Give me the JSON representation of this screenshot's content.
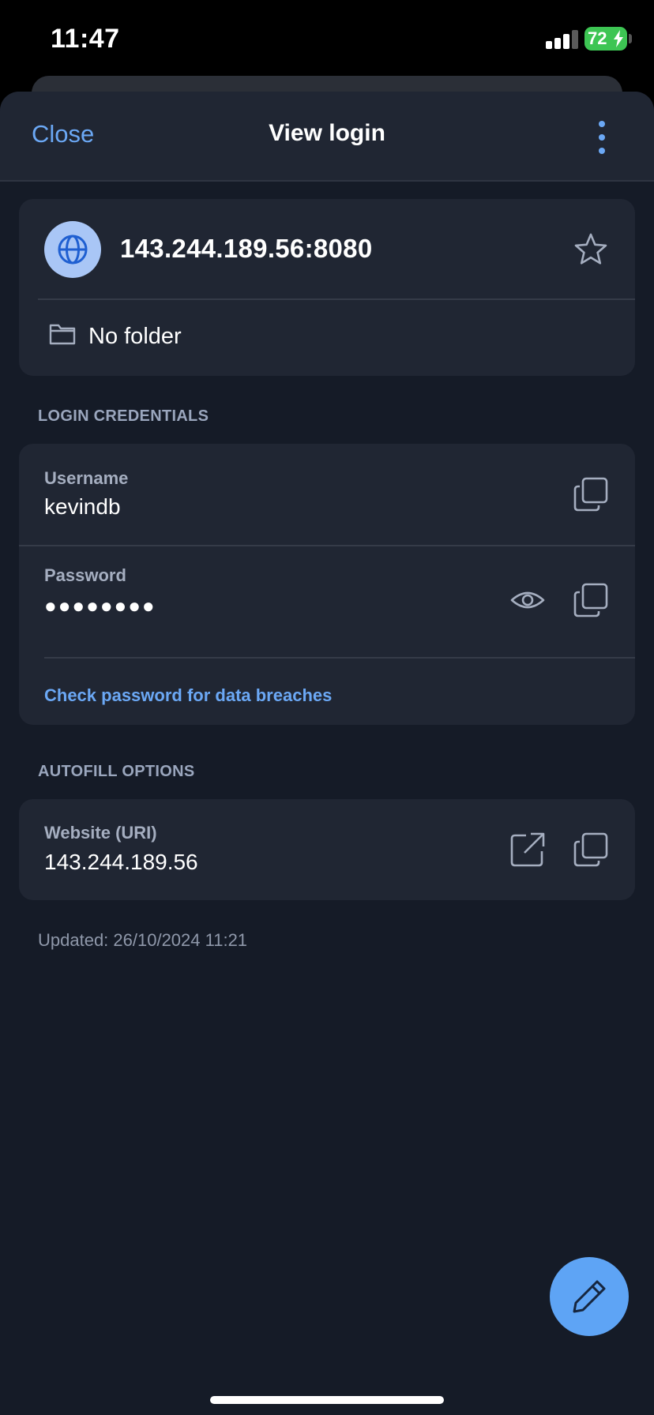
{
  "status_bar": {
    "time": "11:47",
    "battery_percent": "72",
    "signal_icon": "cellular-signal-icon",
    "battery_color": "#3dc553"
  },
  "nav": {
    "close_label": "Close",
    "title": "View login",
    "more_icon": "more-vertical-icon"
  },
  "item": {
    "name": "143.244.189.56:8080",
    "icon": "globe-icon",
    "favorite_icon": "star-icon",
    "folder_icon": "folder-icon",
    "folder": "No folder"
  },
  "login_credentials": {
    "section_label": "LOGIN CREDENTIALS",
    "username_label": "Username",
    "username_value": "kevindb",
    "password_label": "Password",
    "password_masked": "●●●●●●●●",
    "check_breaches_label": "Check password for data breaches"
  },
  "autofill": {
    "section_label": "AUTOFILL OPTIONS",
    "website_label": "Website (URI)",
    "website_value": "143.244.189.56"
  },
  "updated_text": "Updated: 26/10/2024 11:21",
  "fab_icon": "pencil-edit-icon",
  "colors": {
    "accent": "#6ba8f5",
    "background": "#151b27",
    "card": "#202633",
    "fab": "#5ea4f5"
  }
}
